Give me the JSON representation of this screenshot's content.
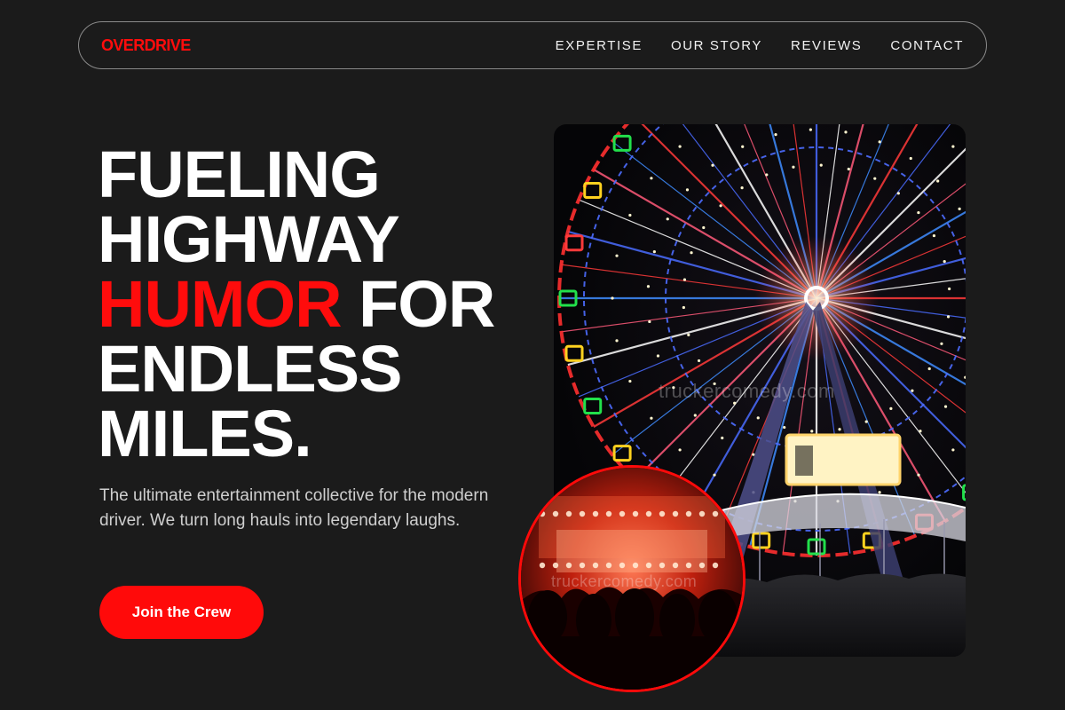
{
  "nav": {
    "brand": "OVERDRIVE",
    "links": [
      "EXPERTISE",
      "OUR STORY",
      "REVIEWS",
      "CONTACT"
    ]
  },
  "hero": {
    "title_lines": [
      [
        {
          "text": "FUELING",
          "accent": false
        }
      ],
      [
        {
          "text": "HIGHWAY",
          "accent": false
        }
      ],
      [
        {
          "text": "HUMOR",
          "accent": true
        },
        {
          "text": " FOR",
          "accent": false
        }
      ],
      [
        {
          "text": "ENDLESS",
          "accent": false
        }
      ],
      [
        {
          "text": "MILES.",
          "accent": false
        }
      ]
    ],
    "subtitle": "The ultimate entertainment collective for the modern driver. We turn long hauls into legendary laughs.",
    "cta_label": "Join the Crew"
  },
  "images": {
    "main_watermark": "truckercomedy.com",
    "inset_watermark": "truckercomedy.com"
  },
  "colors": {
    "accent": "#ff0c0c",
    "background": "#1b1b1b",
    "text": "#ffffff",
    "muted": "#cfcfcf"
  }
}
